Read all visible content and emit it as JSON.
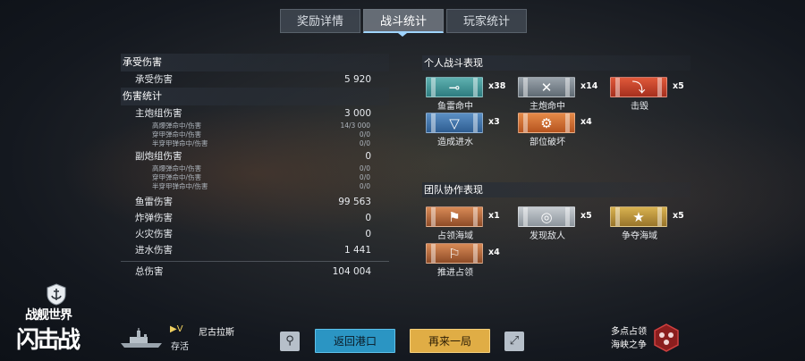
{
  "tabs": [
    {
      "label": "奖励详情",
      "active": false
    },
    {
      "label": "战斗统计",
      "active": true
    },
    {
      "label": "玩家统计",
      "active": false
    }
  ],
  "stats": {
    "received_header": "承受伤害",
    "received_row": {
      "label": "承受伤害",
      "value": "5 920"
    },
    "damage_header": "伤害统计",
    "main_battery": {
      "label": "主炮组伤害",
      "value": "3 000"
    },
    "main_sub": [
      {
        "label": "高爆弹命中/伤害",
        "value": "14/3 000"
      },
      {
        "label": "穿甲弹命中/伤害",
        "value": "0/0"
      },
      {
        "label": "半穿甲弹命中/伤害",
        "value": "0/0"
      }
    ],
    "secondary": {
      "label": "副炮组伤害",
      "value": "0"
    },
    "secondary_sub": [
      {
        "label": "高爆弹命中/伤害",
        "value": "0/0"
      },
      {
        "label": "穿甲弹命中/伤害",
        "value": "0/0"
      },
      {
        "label": "半穿甲弹命中/伤害",
        "value": "0/0"
      }
    ],
    "torpedo": {
      "label": "鱼雷伤害",
      "value": "99 563"
    },
    "bomb": {
      "label": "炸弹伤害",
      "value": "0"
    },
    "fire": {
      "label": "火灾伤害",
      "value": "0"
    },
    "flooding": {
      "label": "进水伤害",
      "value": "1 441"
    },
    "total": {
      "label": "总伤害",
      "value": "104 004"
    }
  },
  "personal": {
    "header": "个人战斗表现",
    "medals": [
      {
        "name": "鱼雷命中",
        "count": "x38",
        "color": "teal",
        "icon": "torpedo-icon",
        "glyph": "⊸"
      },
      {
        "name": "主炮命中",
        "count": "x14",
        "color": "silver",
        "icon": "crossed-guns-icon",
        "glyph": "✕"
      },
      {
        "name": "击毁",
        "count": "x5",
        "color": "red",
        "icon": "sinking-ship-icon",
        "glyph": "⤵"
      },
      {
        "name": "造成进水",
        "count": "x3",
        "color": "blue",
        "icon": "flooding-icon",
        "glyph": "▽"
      },
      {
        "name": "部位破坏",
        "count": "x4",
        "color": "orange",
        "icon": "module-destroy-icon",
        "glyph": "⚙"
      }
    ]
  },
  "team": {
    "header": "团队协作表现",
    "medals": [
      {
        "name": "占领海域",
        "count": "x1",
        "color": "copper",
        "icon": "flag-icon",
        "glyph": "⚑"
      },
      {
        "name": "发现敌人",
        "count": "x5",
        "color": "silver2",
        "icon": "radar-icon",
        "glyph": "◎"
      },
      {
        "name": "争夺海域",
        "count": "x5",
        "color": "gold",
        "icon": "contest-stars-icon",
        "glyph": "★"
      },
      {
        "name": "推进占领",
        "count": "x4",
        "color": "copper",
        "icon": "advance-flag-icon",
        "glyph": "⚐"
      }
    ]
  },
  "bottom": {
    "rank": "V",
    "ship_name": "尼古拉斯",
    "status": "存活",
    "return_port": "返回港口",
    "play_again": "再来一局",
    "mode_line1": "多点占领",
    "mode_line2": "海峡之争"
  },
  "logo": {
    "line1": "战舰世界",
    "line2": "闪击战"
  },
  "colors": {
    "accent": "#9fd4ff",
    "return_button": "#2b95c3",
    "again_button": "#e0ad45"
  }
}
